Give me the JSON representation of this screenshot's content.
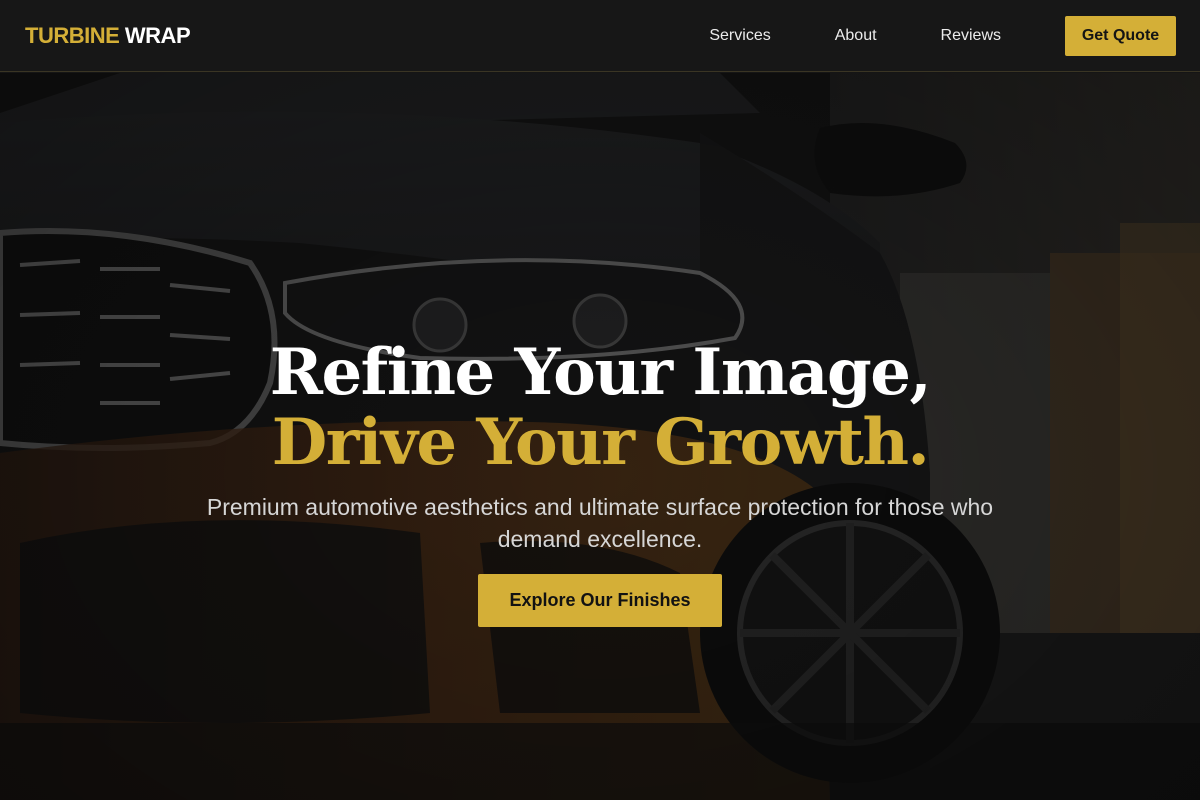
{
  "brand": {
    "logo_part1": "TURBINE",
    "logo_part2": "WRAP"
  },
  "nav": {
    "links": [
      {
        "label": "Services"
      },
      {
        "label": "About"
      },
      {
        "label": "Reviews"
      }
    ],
    "quote_button": "Get Quote"
  },
  "hero": {
    "headline_line1": "Refine Your Image,",
    "headline_line2": "Drive Your Growth.",
    "subtitle": "Premium automotive aesthetics and ultimate surface protection for those who demand excellence.",
    "cta_label": "Explore Our Finishes",
    "background_image": "car-photo"
  },
  "colors": {
    "accent": "#d4af37",
    "nav_background": "#171717",
    "text_light": "#ffffff"
  }
}
